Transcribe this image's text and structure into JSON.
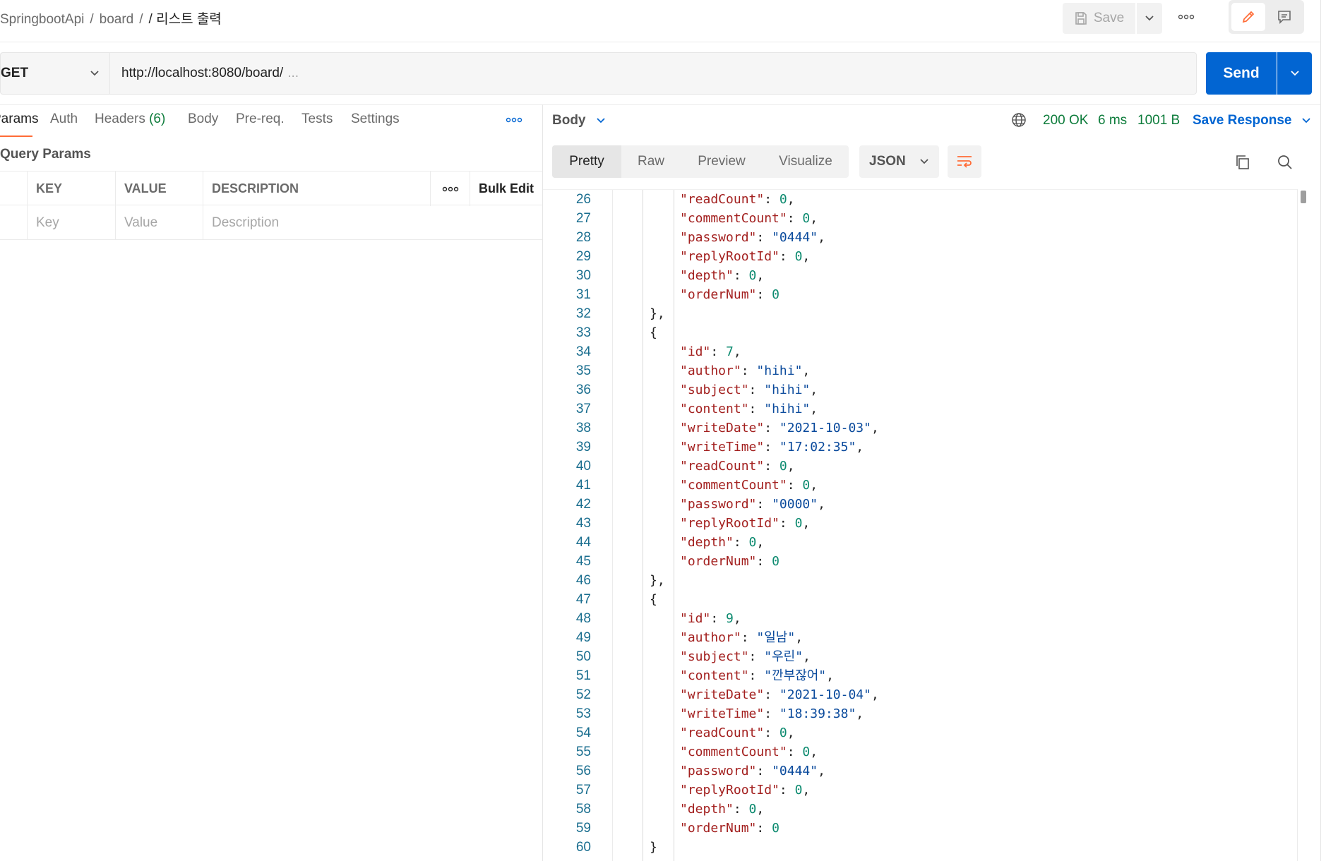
{
  "breadcrumb": {
    "collection": "SpringbootApi",
    "folder": "board",
    "request": "/ 리스트 출력"
  },
  "toolbar": {
    "save_label": "Save"
  },
  "request": {
    "method": "GET",
    "url": "http://localhost:8080/board/",
    "url_ellipsis": "...",
    "send_label": "Send"
  },
  "req_tabs": {
    "params": "Params",
    "auth": "Auth",
    "headers": "Headers",
    "headers_count": "(6)",
    "body": "Body",
    "prereq": "Pre-req.",
    "tests": "Tests",
    "settings": "Settings"
  },
  "query_params": {
    "title": "Query Params",
    "headers": {
      "key": "KEY",
      "value": "VALUE",
      "description": "DESCRIPTION",
      "bulk_edit": "Bulk Edit"
    },
    "placeholders": {
      "key": "Key",
      "value": "Value",
      "description": "Description"
    }
  },
  "response": {
    "body_label": "Body",
    "status": "200 OK",
    "time": "6 ms",
    "size": "1001 B",
    "save_response": "Save Response",
    "view_tabs": {
      "pretty": "Pretty",
      "raw": "Raw",
      "preview": "Preview",
      "visualize": "Visualize"
    },
    "format": "JSON",
    "lines": [
      {
        "n": "26",
        "indent": 2,
        "key": "readCount",
        "val": "0",
        "type": "num",
        "comma": true
      },
      {
        "n": "27",
        "indent": 2,
        "key": "commentCount",
        "val": "0",
        "type": "num",
        "comma": true
      },
      {
        "n": "28",
        "indent": 2,
        "key": "password",
        "val": "0444",
        "type": "str",
        "comma": true
      },
      {
        "n": "29",
        "indent": 2,
        "key": "replyRootId",
        "val": "0",
        "type": "num",
        "comma": true
      },
      {
        "n": "30",
        "indent": 2,
        "key": "depth",
        "val": "0",
        "type": "num",
        "comma": true
      },
      {
        "n": "31",
        "indent": 2,
        "key": "orderNum",
        "val": "0",
        "type": "num",
        "comma": false
      },
      {
        "n": "32",
        "indent": 1,
        "punct": "},"
      },
      {
        "n": "33",
        "indent": 1,
        "punct": "{"
      },
      {
        "n": "34",
        "indent": 2,
        "key": "id",
        "val": "7",
        "type": "num",
        "comma": true
      },
      {
        "n": "35",
        "indent": 2,
        "key": "author",
        "val": "hihi",
        "type": "str",
        "comma": true
      },
      {
        "n": "36",
        "indent": 2,
        "key": "subject",
        "val": "hihi",
        "type": "str",
        "comma": true
      },
      {
        "n": "37",
        "indent": 2,
        "key": "content",
        "val": "hihi",
        "type": "str",
        "comma": true
      },
      {
        "n": "38",
        "indent": 2,
        "key": "writeDate",
        "val": "2021-10-03",
        "type": "str",
        "comma": true
      },
      {
        "n": "39",
        "indent": 2,
        "key": "writeTime",
        "val": "17:02:35",
        "type": "str",
        "comma": true
      },
      {
        "n": "40",
        "indent": 2,
        "key": "readCount",
        "val": "0",
        "type": "num",
        "comma": true
      },
      {
        "n": "41",
        "indent": 2,
        "key": "commentCount",
        "val": "0",
        "type": "num",
        "comma": true
      },
      {
        "n": "42",
        "indent": 2,
        "key": "password",
        "val": "0000",
        "type": "str",
        "comma": true
      },
      {
        "n": "43",
        "indent": 2,
        "key": "replyRootId",
        "val": "0",
        "type": "num",
        "comma": true
      },
      {
        "n": "44",
        "indent": 2,
        "key": "depth",
        "val": "0",
        "type": "num",
        "comma": true
      },
      {
        "n": "45",
        "indent": 2,
        "key": "orderNum",
        "val": "0",
        "type": "num",
        "comma": false
      },
      {
        "n": "46",
        "indent": 1,
        "punct": "},"
      },
      {
        "n": "47",
        "indent": 1,
        "punct": "{"
      },
      {
        "n": "48",
        "indent": 2,
        "key": "id",
        "val": "9",
        "type": "num",
        "comma": true
      },
      {
        "n": "49",
        "indent": 2,
        "key": "author",
        "val": "일남",
        "type": "str",
        "comma": true
      },
      {
        "n": "50",
        "indent": 2,
        "key": "subject",
        "val": "우린",
        "type": "str",
        "comma": true
      },
      {
        "n": "51",
        "indent": 2,
        "key": "content",
        "val": "깐부잖어",
        "type": "str",
        "comma": true
      },
      {
        "n": "52",
        "indent": 2,
        "key": "writeDate",
        "val": "2021-10-04",
        "type": "str",
        "comma": true
      },
      {
        "n": "53",
        "indent": 2,
        "key": "writeTime",
        "val": "18:39:38",
        "type": "str",
        "comma": true
      },
      {
        "n": "54",
        "indent": 2,
        "key": "readCount",
        "val": "0",
        "type": "num",
        "comma": true
      },
      {
        "n": "55",
        "indent": 2,
        "key": "commentCount",
        "val": "0",
        "type": "num",
        "comma": true
      },
      {
        "n": "56",
        "indent": 2,
        "key": "password",
        "val": "0444",
        "type": "str",
        "comma": true
      },
      {
        "n": "57",
        "indent": 2,
        "key": "replyRootId",
        "val": "0",
        "type": "num",
        "comma": true
      },
      {
        "n": "58",
        "indent": 2,
        "key": "depth",
        "val": "0",
        "type": "num",
        "comma": true
      },
      {
        "n": "59",
        "indent": 2,
        "key": "orderNum",
        "val": "0",
        "type": "num",
        "comma": false
      },
      {
        "n": "60",
        "indent": 1,
        "punct": "}"
      }
    ]
  },
  "colors": {
    "accent": "#ff6c37",
    "send": "#0265d2",
    "status_ok": "#0d7c3b",
    "json_key": "#a3201f",
    "json_string": "#0a4a9c",
    "json_number": "#0c8a6f"
  },
  "icons": [
    "save-icon",
    "chevron-down-icon",
    "more-icon",
    "pencil-icon",
    "comment-icon",
    "globe-icon",
    "wrap-lines-icon",
    "copy-icon",
    "search-icon"
  ]
}
